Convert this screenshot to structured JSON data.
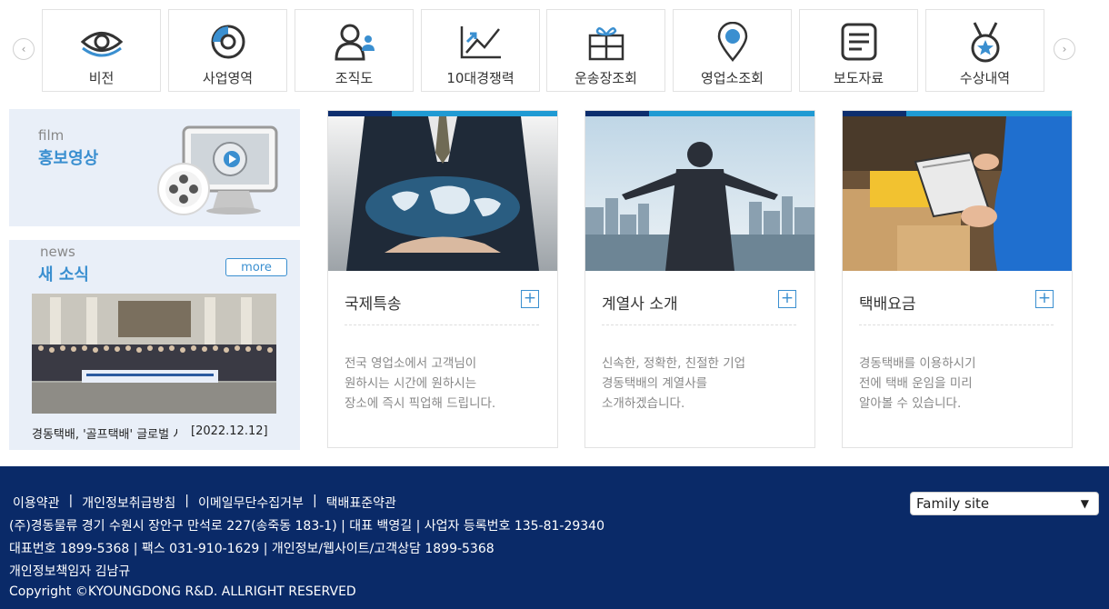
{
  "quick_menu": {
    "prev_symbol": "‹",
    "next_symbol": "›",
    "items": [
      {
        "label": "비전",
        "icon": "eye-icon"
      },
      {
        "label": "사업영역",
        "icon": "pie-chart-icon"
      },
      {
        "label": "조직도",
        "icon": "people-icon"
      },
      {
        "label": "10대경쟁력",
        "icon": "trend-chart-icon"
      },
      {
        "label": "운송장조회",
        "icon": "gift-box-icon"
      },
      {
        "label": "영업소조회",
        "icon": "location-pin-icon"
      },
      {
        "label": "보도자료",
        "icon": "document-list-icon"
      },
      {
        "label": "수상내역",
        "icon": "medal-icon"
      }
    ]
  },
  "film": {
    "en": "film",
    "title": "홍보영상"
  },
  "news": {
    "en": "news",
    "title": "새 소식",
    "more": "more",
    "item_title": "경동택배, '골프택배' 글로벌 서비스 협약",
    "item_date": "[2022.12.12]"
  },
  "cards": [
    {
      "title": "국제특송",
      "plus": "+",
      "desc": [
        "전국 영업소에서 고객님이",
        "원하시는 시간에 원하시는",
        "장소에 즉시 픽업해 드립니다."
      ]
    },
    {
      "title": "계열사 소개",
      "plus": "+",
      "desc": [
        "신속한, 정확한, 친절한 기업",
        "경동택배의 계열사를",
        "소개하겠습니다."
      ]
    },
    {
      "title": "택배요금",
      "plus": "+",
      "desc": [
        "경동택배를 이용하시기",
        "전에 택배 운임을 미리",
        "알아볼 수 있습니다."
      ]
    }
  ],
  "footer": {
    "links": [
      "이용약관",
      "개인정보취급방침",
      "이메일무단수집거부",
      "택배표준약관"
    ],
    "separator": "|",
    "line1": "(주)경동물류 경기 수원시 장안구 만석로 227(송죽동 183-1) | 대표 백영길 | 사업자 등록번호 135-81-29340",
    "line2": "대표번호 1899-5368 | 팩스 031-910-1629 | 개인정보/웹사이트/고객상담 1899-5368",
    "line3": "개인정보책임자 김남규",
    "copyright": "Copyright ©KYOUNGDONG R&D. ALLRIGHT RESERVED",
    "family_site": "Family site"
  },
  "colors": {
    "accent": "#3a8fd0",
    "navy": "#0a2a68",
    "cyan": "#1f9ad3",
    "panel": "#e9eff8"
  }
}
